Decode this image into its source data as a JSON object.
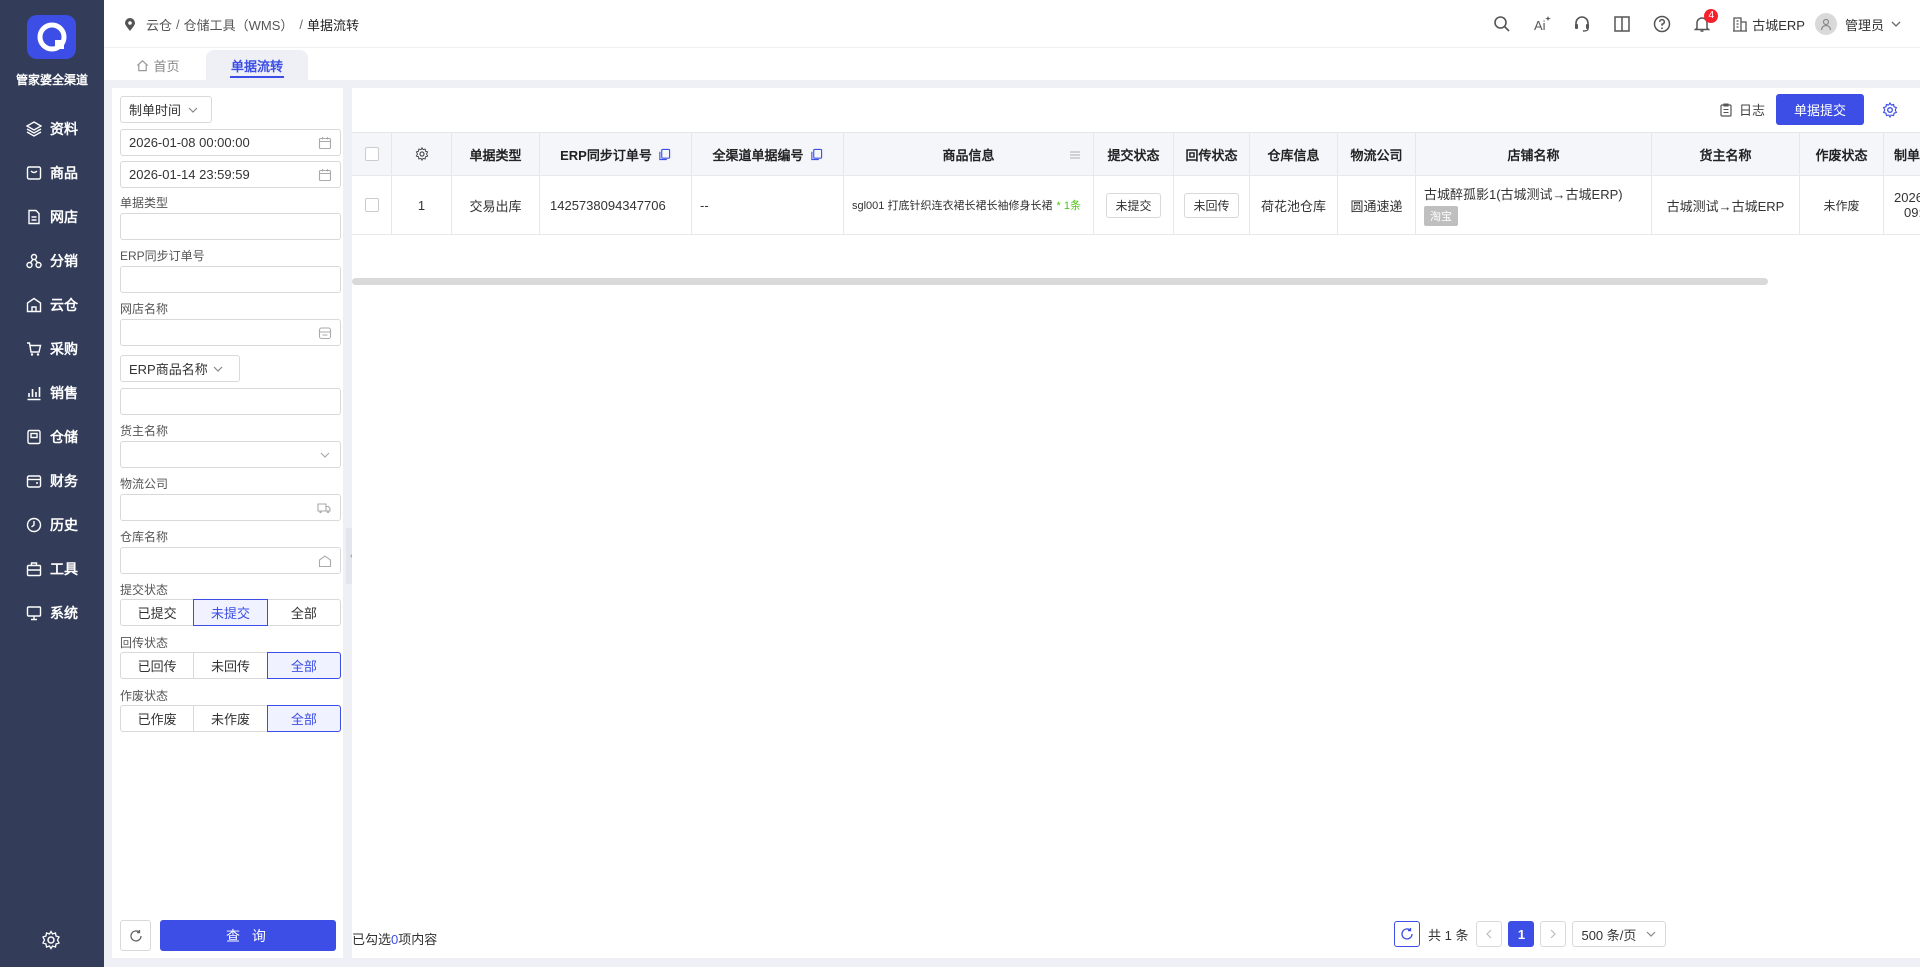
{
  "sidebar": {
    "brand": "管家婆全渠道",
    "items": [
      {
        "label": "资料",
        "icon": "layers-icon"
      },
      {
        "label": "商品",
        "icon": "box-icon"
      },
      {
        "label": "网店",
        "icon": "file-icon"
      },
      {
        "label": "分销",
        "icon": "network-icon"
      },
      {
        "label": "云仓",
        "icon": "warehouse-icon"
      },
      {
        "label": "采购",
        "icon": "cart-icon"
      },
      {
        "label": "销售",
        "icon": "chart-icon"
      },
      {
        "label": "仓储",
        "icon": "storage-icon"
      },
      {
        "label": "财务",
        "icon": "wallet-icon"
      },
      {
        "label": "历史",
        "icon": "history-icon"
      },
      {
        "label": "工具",
        "icon": "toolbox-icon"
      },
      {
        "label": "系统",
        "icon": "monitor-icon"
      }
    ]
  },
  "topbar": {
    "breadcrumb": [
      "云仓",
      "仓储工具（WMS）",
      "单据流转"
    ],
    "notification_count": "4",
    "company": "古城ERP",
    "user": "管理员"
  },
  "tabs": [
    {
      "label": "首页",
      "active": false
    },
    {
      "label": "单据流转",
      "active": true
    }
  ],
  "filter": {
    "time_type": "制单时间",
    "start_time": "2026-01-08 00:00:00",
    "end_time": "2026-01-14 23:59:59",
    "doc_type_label": "单据类型",
    "erp_order_label": "ERP同步订单号",
    "shop_label": "网店名称",
    "product_type": "ERP商品名称",
    "owner_label": "货主名称",
    "logistics_label": "物流公司",
    "warehouse_label": "仓库名称",
    "submit_status_label": "提交状态",
    "submit_status": [
      "已提交",
      "未提交",
      "全部"
    ],
    "return_status_label": "回传状态",
    "return_status": [
      "已回传",
      "未回传",
      "全部"
    ],
    "void_status_label": "作废状态",
    "void_status": [
      "已作废",
      "未作废",
      "全部"
    ],
    "query_label": "查 询"
  },
  "toolbar": {
    "log_label": "日志",
    "submit_label": "单据提交"
  },
  "table": {
    "columns": [
      "单据类型",
      "ERP同步订单号",
      "全渠道单据编号",
      "商品信息",
      "提交状态",
      "回传状态",
      "仓库信息",
      "物流公司",
      "店铺名称",
      "货主名称",
      "作废状态",
      "制单"
    ],
    "rows": [
      {
        "index": "1",
        "doc_type": "交易出库",
        "erp_order": "1425738094347706",
        "channel_no": "--",
        "product": "sgl001 打底针织连衣裙长裙长袖修身长裙",
        "product_count": "* 1条",
        "submit_status": "未提交",
        "return_status": "未回传",
        "warehouse": "荷花池仓库",
        "logistics": "圆通速递",
        "shop": "古城醉孤影1(古城测试→古城ERP)",
        "shop_tag": "淘宝",
        "owner": "古城测试→古城ERP",
        "void_status": "未作废",
        "date_line1": "2026",
        "date_line2": "09:"
      }
    ]
  },
  "footer": {
    "selected_prefix": "已勾选",
    "selected_count": "0",
    "selected_suffix": "项内容",
    "total": "共 1 条",
    "page": "1",
    "page_size": "500 条/页"
  },
  "colors": {
    "accent": "#3c4ee6",
    "sidebar_bg": "#333d59",
    "badge": "#f5222d",
    "green": "#52c41a"
  }
}
